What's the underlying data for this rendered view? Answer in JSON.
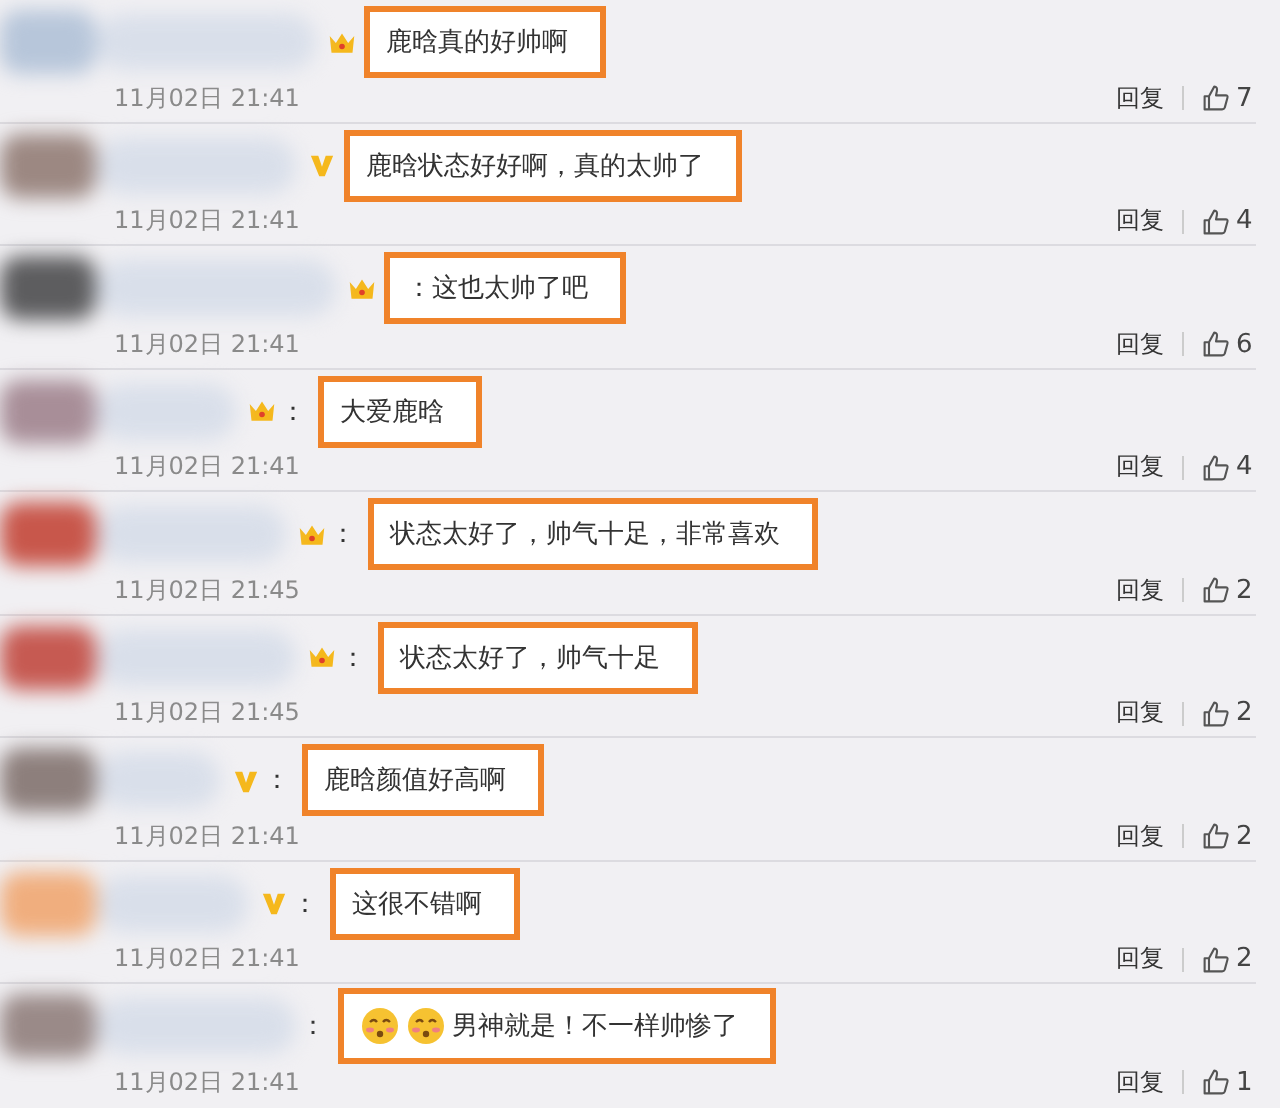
{
  "comments": [
    {
      "color": "#b7c6da",
      "badge": {
        "kind": "crown"
      },
      "text": "鹿晗真的好帅啊",
      "time": "11月02日 21:41",
      "reply": "回复",
      "likes": "7"
    },
    {
      "color": "#9c8882",
      "badge": {
        "kind": "v"
      },
      "text": "鹿晗状态好好啊，真的太帅了",
      "time": "11月02日 21:41",
      "reply": "回复",
      "likes": "4"
    },
    {
      "color": "#5d5d5f",
      "badge": {
        "kind": "crown"
      },
      "text": "：这也太帅了吧",
      "time": "11月02日 21:41",
      "reply": "回复",
      "likes": "6"
    },
    {
      "color": "#a88e98",
      "badge": {
        "kind": "crown"
      },
      "colon": "：",
      "text": "大爱鹿晗",
      "time": "11月02日 21:41",
      "reply": "回复",
      "likes": "4"
    },
    {
      "color": "#c8574b",
      "badge": {
        "kind": "crown"
      },
      "colon": "：",
      "text": "状态太好了，帅气十足，非常喜欢",
      "time": "11月02日 21:45",
      "reply": "回复",
      "likes": "2"
    },
    {
      "color": "#c65a52",
      "badge": {
        "kind": "crown"
      },
      "colon": "：",
      "text": "状态太好了，帅气十足",
      "time": "11月02日 21:45",
      "reply": "回复",
      "likes": "2"
    },
    {
      "color": "#8d7f7c",
      "badge": {
        "kind": "v"
      },
      "colon": "：",
      "text": "鹿晗颜值好高啊",
      "time": "11月02日 21:41",
      "reply": "回复",
      "likes": "2"
    },
    {
      "color": "#f0ae7e",
      "badge": {
        "kind": "v"
      },
      "colon": "：",
      "text": "这很不错啊",
      "time": "11月02日 21:41",
      "reply": "回复",
      "likes": "2"
    },
    {
      "color": "#9a8a88",
      "colon": "：",
      "emojis": [
        {
          "kind": "kiss-face"
        },
        {
          "kind": "kiss-face"
        }
      ],
      "text": "男神就是！不一样帅惨了",
      "time": "11月02日 21:41",
      "reply": "回复",
      "likes": "1"
    }
  ]
}
